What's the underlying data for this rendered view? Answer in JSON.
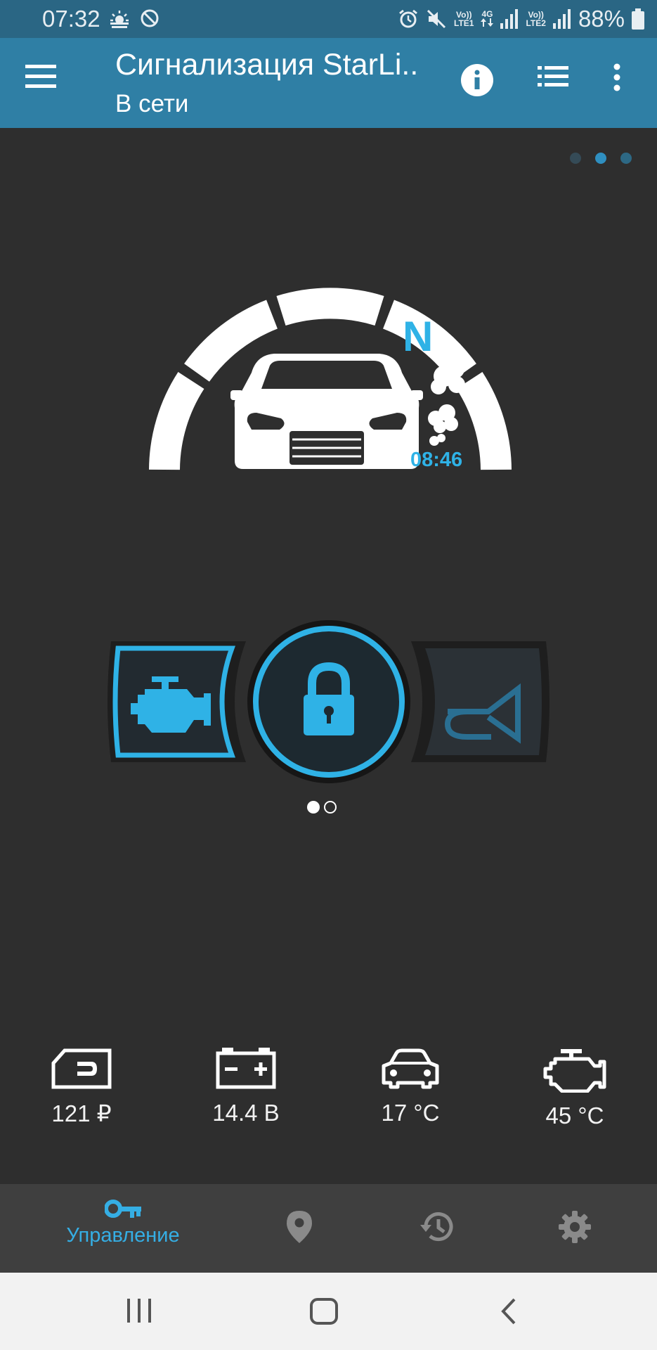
{
  "status_bar": {
    "time": "07:32",
    "net1_top": "Vo))",
    "net1_bottom": "LTE1",
    "net_4g": "4G",
    "net2_top": "Vo))",
    "net2_bottom": "LTE2",
    "battery": "88%"
  },
  "app_bar": {
    "title": "Сигнализация StarLi..",
    "subtitle": "В сети"
  },
  "gauge": {
    "gear": "N",
    "timer": "08:46"
  },
  "sensors": [
    {
      "value": "121 ₽",
      "icon": "sim-card-icon"
    },
    {
      "value": "14.4 В",
      "icon": "battery-icon"
    },
    {
      "value": "17 °C",
      "icon": "car-icon"
    },
    {
      "value": "45 °C",
      "icon": "engine-icon"
    }
  ],
  "bottom_nav": {
    "control_label": "Управление"
  },
  "colors": {
    "accent": "#2fb2e6",
    "appbar": "#2f7fa5",
    "statusbar": "#2a6684",
    "background": "#2e2e2e",
    "bottom_nav": "#3f3f3f"
  }
}
